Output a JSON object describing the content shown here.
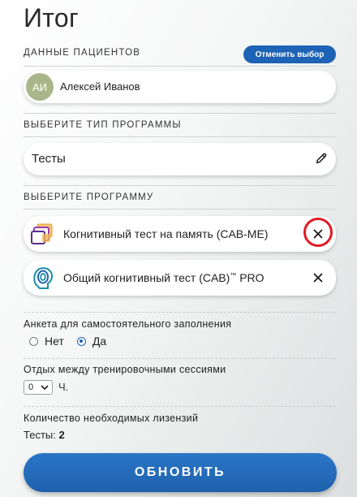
{
  "page": {
    "title": "Итог"
  },
  "patients": {
    "section_label": "ДАННЫЕ ПАЦИЕНТОВ",
    "cancel_label": "Отменить выбор",
    "avatar_initials": "АИ",
    "avatar_color": "#a9b68a",
    "name": "Алексей Иванов"
  },
  "program_type": {
    "section_label": "ВЫБЕРИТЕ ТИП ПРОГРАММЫ",
    "value": "Тесты",
    "icon": "pencil-icon"
  },
  "programs": {
    "section_label": "ВЫБЕРИТЕ ПРОГРАММУ",
    "items": [
      {
        "label": "Когнитивный тест на память (CAB-ME)",
        "icon": "cab-me-logo-icon",
        "remove_icon": "close-icon"
      },
      {
        "label_main": "Общий когнитивный тест (CAB)",
        "label_tm": "™",
        "label_tail": " PRO",
        "icon": "cab-pro-logo-icon",
        "remove_icon": "close-icon"
      }
    ],
    "highlight_color": "#e01b25"
  },
  "self_questionnaire": {
    "label": "Анкета для самостоятельного заполнения",
    "options": [
      "Нет",
      "Да"
    ],
    "selected": "Да"
  },
  "rest": {
    "label": "Отдых между тренировочными сессиями",
    "value": "0",
    "unit": "Ч."
  },
  "licenses": {
    "label": "Количество необходимых лизензий",
    "tests_label": "Тесты:",
    "tests_count": "2"
  },
  "update_label": "ОБНОВИТЬ",
  "colors": {
    "accent": "#1d62b4"
  }
}
